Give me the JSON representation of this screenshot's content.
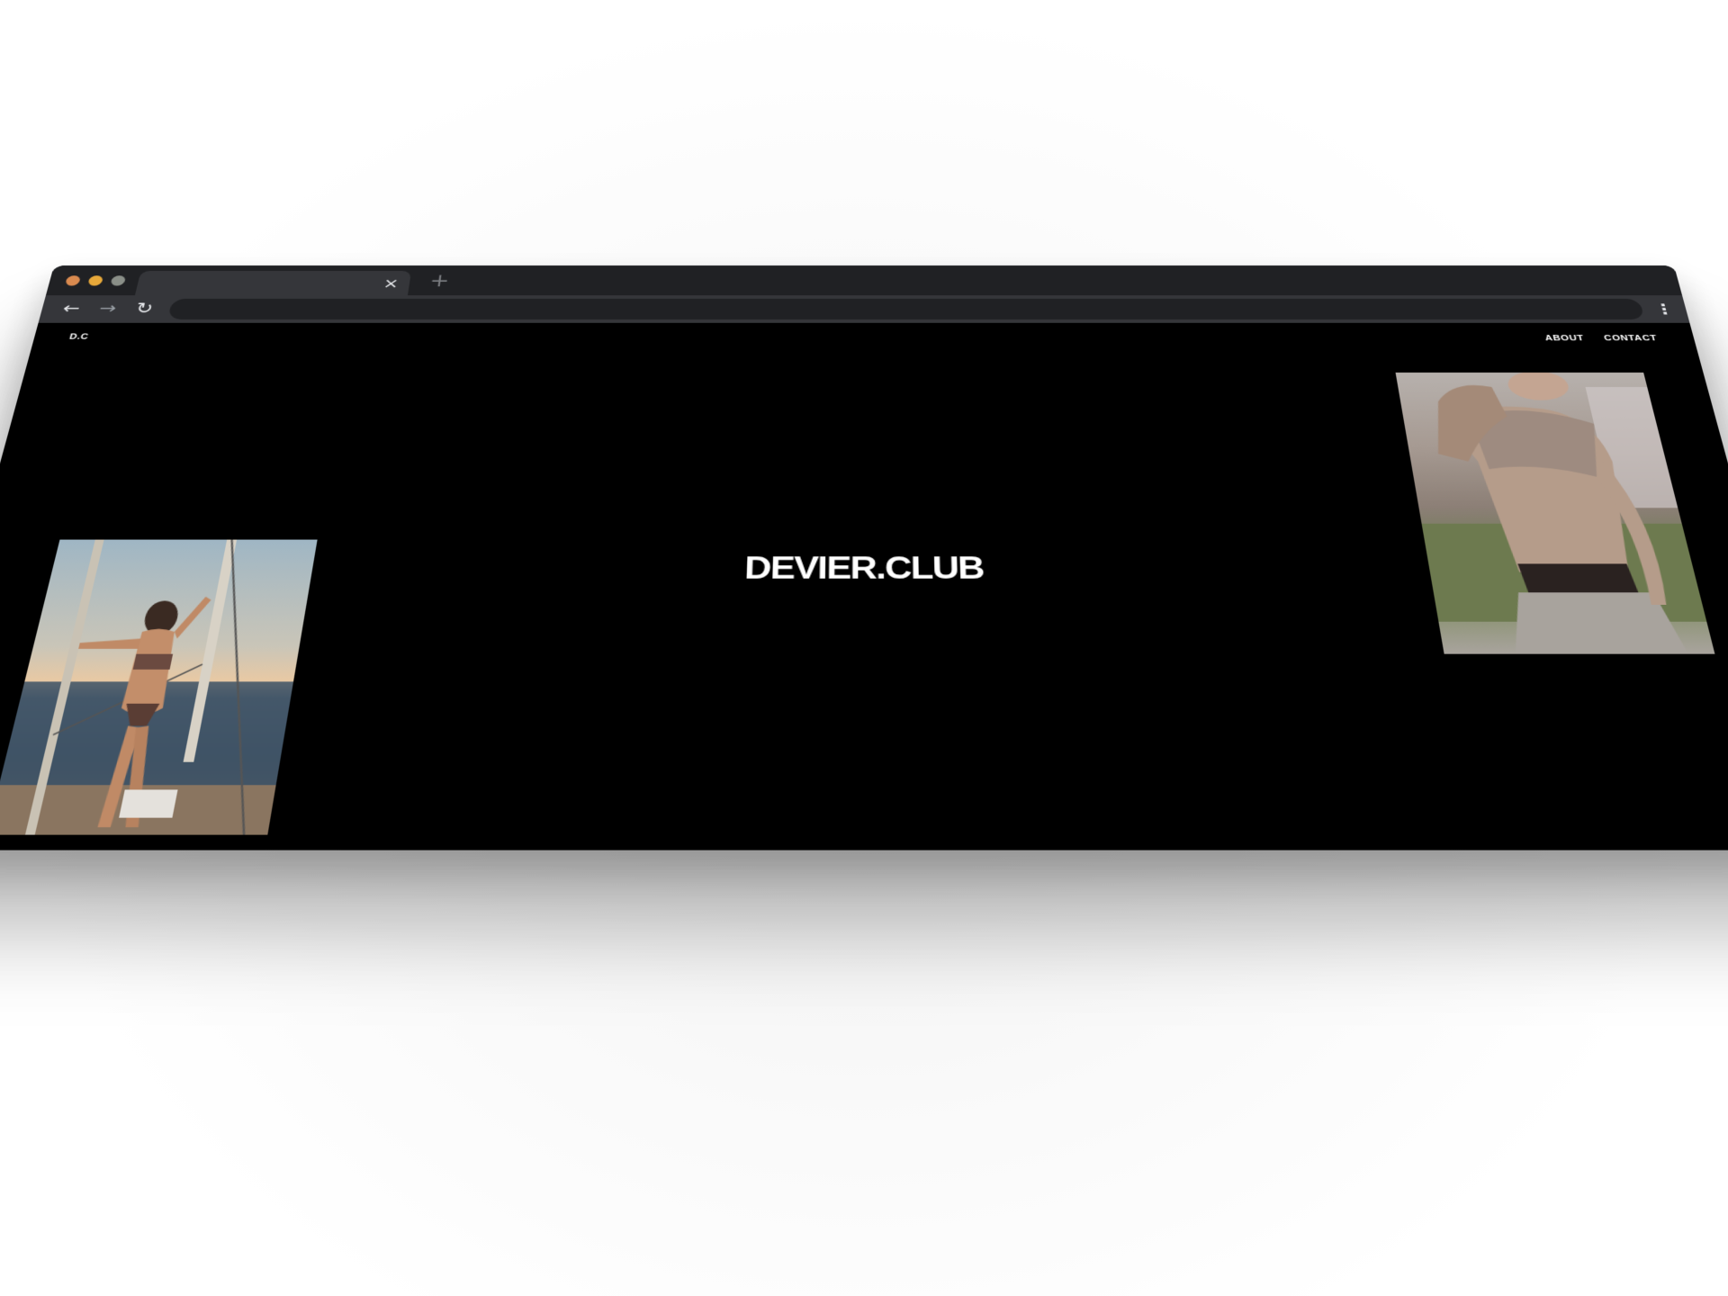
{
  "browser": {
    "tab_close_glyph": "×",
    "new_tab_glyph": "+",
    "back_glyph": "←",
    "forward_glyph": "→",
    "reload_glyph": "↻",
    "menu_glyph": "⋮",
    "address_value": ""
  },
  "site": {
    "logo_small": "D.C",
    "nav": {
      "about": "ABOUT",
      "contact": "CONTACT"
    },
    "hero_title": "DEVIER.CLUB"
  },
  "colors": {
    "tabstrip": "#202124",
    "toolbar": "#35363a",
    "page_background": "#000000",
    "traffic_red": "#d98a4f",
    "traffic_yellow": "#e8a93a",
    "traffic_green": "#8a8f88"
  },
  "icons": {
    "close": "close-icon",
    "new_tab": "plus-icon",
    "back": "arrow-left-icon",
    "forward": "arrow-right-icon",
    "reload": "reload-icon",
    "menu": "kebab-menu-icon"
  }
}
